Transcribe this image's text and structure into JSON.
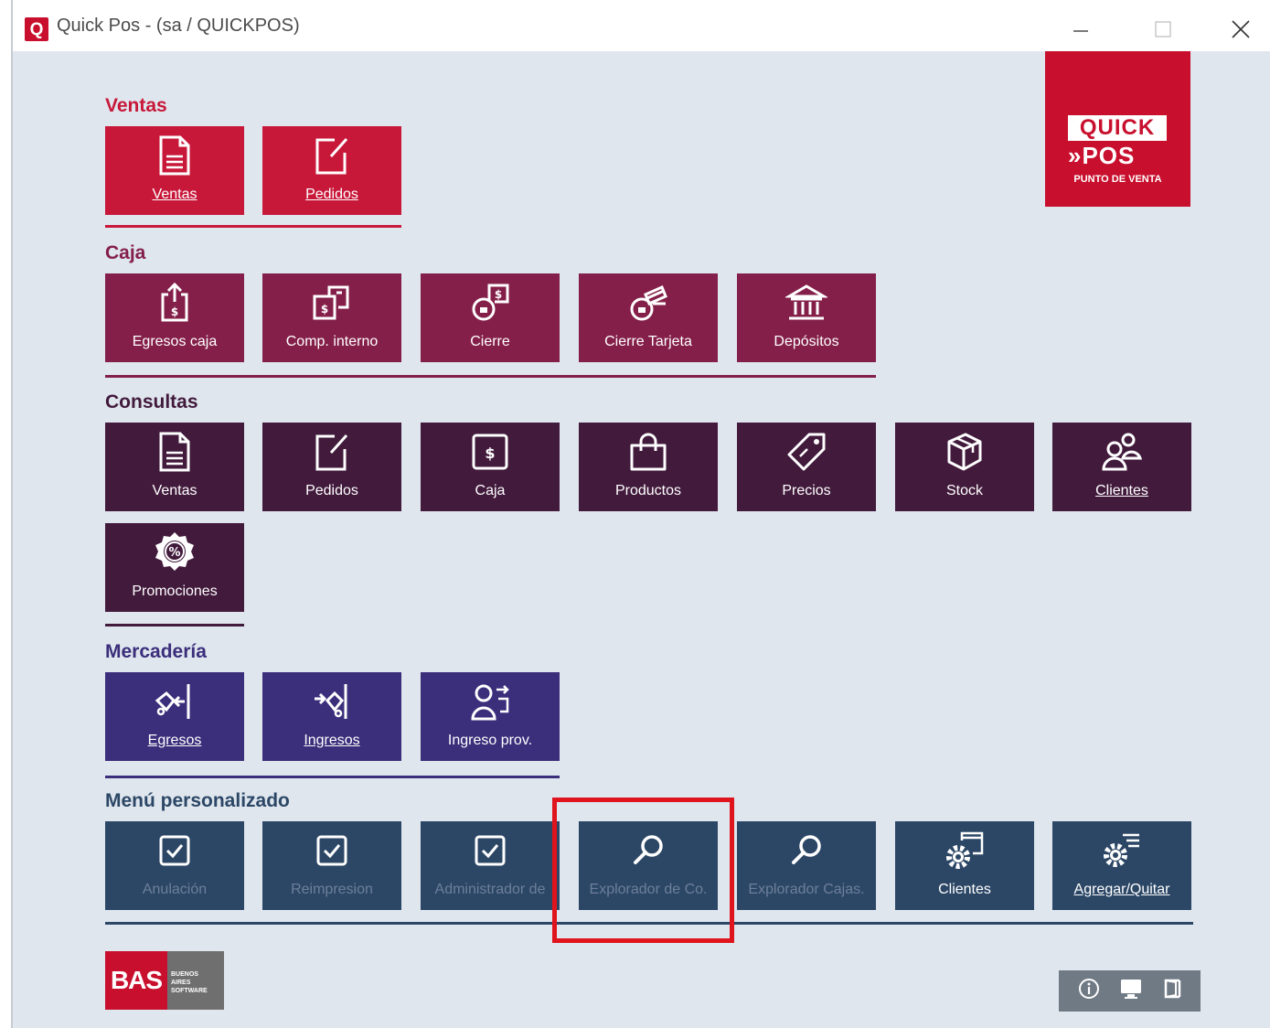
{
  "window": {
    "app_icon_letter": "Q",
    "title": "Quick Pos - (sa / QUICKPOS)"
  },
  "logo": {
    "line1": "QUICK",
    "line2": "»POS",
    "tagline": "PUNTO DE VENTA"
  },
  "sections": {
    "ventas": {
      "title": "Ventas",
      "color": "#c8183a",
      "items": [
        {
          "label": "Ventas",
          "icon": "document-icon"
        },
        {
          "label": "Pedidos",
          "icon": "edit-note-icon"
        }
      ]
    },
    "caja": {
      "title": "Caja",
      "color": "#841f49",
      "items": [
        {
          "label": "Egresos caja",
          "icon": "cash-out-icon"
        },
        {
          "label": "Comp. interno",
          "icon": "cash-transfer-icon"
        },
        {
          "label": "Cierre",
          "icon": "cash-close-icon"
        },
        {
          "label": "Cierre Tarjeta",
          "icon": "card-close-icon"
        },
        {
          "label": "Depósitos",
          "icon": "bank-icon"
        }
      ]
    },
    "consultas": {
      "title": "Consultas",
      "color": "#421a3c",
      "items": [
        {
          "label": "Ventas",
          "icon": "document-icon"
        },
        {
          "label": "Pedidos",
          "icon": "edit-note-icon"
        },
        {
          "label": "Caja",
          "icon": "cash-icon"
        },
        {
          "label": "Productos",
          "icon": "shopping-bag-icon"
        },
        {
          "label": "Precios",
          "icon": "price-tag-icon"
        },
        {
          "label": "Stock",
          "icon": "boxes-icon"
        },
        {
          "label": "Clientes",
          "icon": "users-icon"
        },
        {
          "label": "Promociones",
          "icon": "percent-badge-icon"
        }
      ]
    },
    "mercaderia": {
      "title": "Mercadería",
      "color": "#3b2e7b",
      "items": [
        {
          "label": "Egresos",
          "icon": "dolly-out-icon"
        },
        {
          "label": "Ingresos",
          "icon": "dolly-in-icon"
        },
        {
          "label": "Ingreso prov.",
          "icon": "supplier-in-icon"
        }
      ]
    },
    "menu": {
      "title": "Menú personalizado",
      "color": "#2c4766",
      "items": [
        {
          "label": "Anulación",
          "icon": "checkbox-icon"
        },
        {
          "label": "Reimpresion",
          "icon": "checkbox-icon"
        },
        {
          "label": "Administrador de",
          "icon": "checkbox-icon"
        },
        {
          "label": "Explorador de Co.",
          "icon": "search-icon"
        },
        {
          "label": "Explorador Cajas.",
          "icon": "search-icon"
        },
        {
          "label": "Clientes",
          "icon": "gear-window-icon"
        },
        {
          "label": "Agregar/Quitar",
          "icon": "gear-list-icon"
        }
      ]
    }
  },
  "footer": {
    "bas_text": "BAS",
    "bas_sub": [
      "BUENOS",
      "AIRES",
      "SOFTWARE"
    ],
    "status_icons": [
      "info-icon",
      "monitor-icon",
      "exit-icon"
    ]
  }
}
